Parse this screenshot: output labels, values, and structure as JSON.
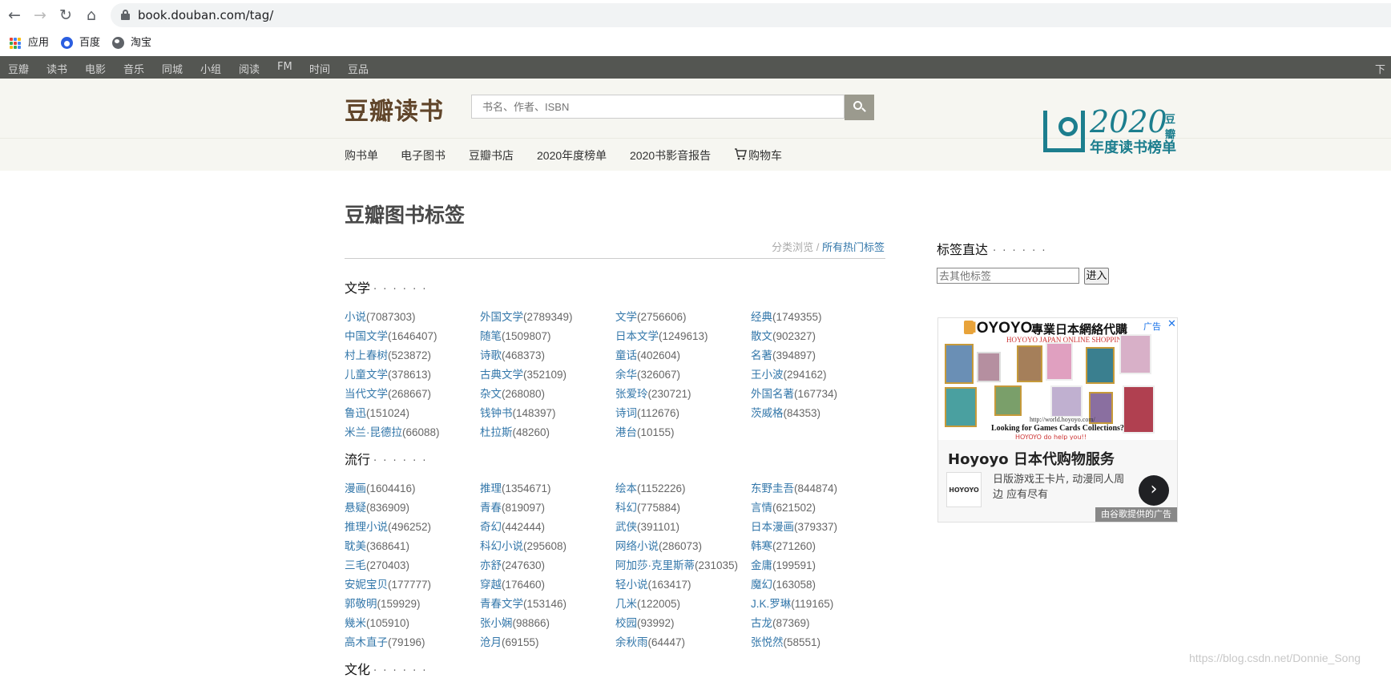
{
  "browser": {
    "url": "book.douban.com/tag/",
    "bookmarks": [
      "应用",
      "百度",
      "淘宝"
    ]
  },
  "global_nav": [
    "豆瓣",
    "读书",
    "电影",
    "音乐",
    "同城",
    "小组",
    "阅读",
    "FM",
    "时间",
    "豆品"
  ],
  "global_nav_right": "下载",
  "header": {
    "logo": "豆瓣读书",
    "search_placeholder": "书名、作者、ISBN",
    "subnav": [
      "购书单",
      "电子图书",
      "豆瓣书店",
      "2020年度榜单",
      "2020书影音报告",
      "购物车"
    ],
    "promo": {
      "year": "2020",
      "brand": "豆瓣",
      "subtitle": "年度读书榜单"
    }
  },
  "main": {
    "title": "豆瓣图书标签",
    "toplinks": {
      "inactive": "分类浏览",
      "separator": " / ",
      "active": "所有热门标签"
    },
    "sections": [
      {
        "name": "文学",
        "dots": "· · · · · ·",
        "tags": [
          {
            "name": "小说",
            "count": "(7087303)"
          },
          {
            "name": "外国文学",
            "count": "(2789349)"
          },
          {
            "name": "文学",
            "count": "(2756606)"
          },
          {
            "name": "经典",
            "count": "(1749355)"
          },
          {
            "name": "中国文学",
            "count": "(1646407)"
          },
          {
            "name": "随笔",
            "count": "(1509807)"
          },
          {
            "name": "日本文学",
            "count": "(1249613)"
          },
          {
            "name": "散文",
            "count": "(902327)"
          },
          {
            "name": "村上春树",
            "count": "(523872)"
          },
          {
            "name": "诗歌",
            "count": "(468373)"
          },
          {
            "name": "童话",
            "count": "(402604)"
          },
          {
            "name": "名著",
            "count": "(394897)"
          },
          {
            "name": "儿童文学",
            "count": "(378613)"
          },
          {
            "name": "古典文学",
            "count": "(352109)"
          },
          {
            "name": "余华",
            "count": "(326067)"
          },
          {
            "name": "王小波",
            "count": "(294162)"
          },
          {
            "name": "当代文学",
            "count": "(268667)"
          },
          {
            "name": "杂文",
            "count": "(268080)"
          },
          {
            "name": "张爱玲",
            "count": "(230721)"
          },
          {
            "name": "外国名著",
            "count": "(167734)"
          },
          {
            "name": "鲁迅",
            "count": "(151024)"
          },
          {
            "name": "钱钟书",
            "count": "(148397)"
          },
          {
            "name": "诗词",
            "count": "(112676)"
          },
          {
            "name": "茨威格",
            "count": "(84353)"
          },
          {
            "name": "米兰·昆德拉",
            "count": "(66088)"
          },
          {
            "name": "杜拉斯",
            "count": "(48260)"
          },
          {
            "name": "港台",
            "count": "(10155)"
          }
        ]
      },
      {
        "name": "流行",
        "dots": "· · · · · ·",
        "tags": [
          {
            "name": "漫画",
            "count": "(1604416)"
          },
          {
            "name": "推理",
            "count": "(1354671)"
          },
          {
            "name": "绘本",
            "count": "(1152226)"
          },
          {
            "name": "东野圭吾",
            "count": "(844874)"
          },
          {
            "name": "悬疑",
            "count": "(836909)"
          },
          {
            "name": "青春",
            "count": "(819097)"
          },
          {
            "name": "科幻",
            "count": "(775884)"
          },
          {
            "name": "言情",
            "count": "(621502)"
          },
          {
            "name": "推理小说",
            "count": "(496252)"
          },
          {
            "name": "奇幻",
            "count": "(442444)"
          },
          {
            "name": "武侠",
            "count": "(391101)"
          },
          {
            "name": "日本漫画",
            "count": "(379337)"
          },
          {
            "name": "耽美",
            "count": "(368641)"
          },
          {
            "name": "科幻小说",
            "count": "(295608)"
          },
          {
            "name": "网络小说",
            "count": "(286073)"
          },
          {
            "name": "韩寒",
            "count": "(271260)"
          },
          {
            "name": "三毛",
            "count": "(270403)"
          },
          {
            "name": "亦舒",
            "count": "(247630)"
          },
          {
            "name": "阿加莎·克里斯蒂",
            "count": "(231035)"
          },
          {
            "name": "金庸",
            "count": "(199591)"
          },
          {
            "name": "安妮宝贝",
            "count": "(177777)"
          },
          {
            "name": "穿越",
            "count": "(176460)"
          },
          {
            "name": "轻小说",
            "count": "(163417)"
          },
          {
            "name": "魔幻",
            "count": "(163058)"
          },
          {
            "name": "郭敬明",
            "count": "(159929)"
          },
          {
            "name": "青春文学",
            "count": "(153146)"
          },
          {
            "name": "几米",
            "count": "(122005)"
          },
          {
            "name": "J.K.罗琳",
            "count": "(119165)"
          },
          {
            "name": "幾米",
            "count": "(105910)"
          },
          {
            "name": "张小娴",
            "count": "(98866)"
          },
          {
            "name": "校园",
            "count": "(93992)"
          },
          {
            "name": "古龙",
            "count": "(87369)"
          },
          {
            "name": "高木直子",
            "count": "(79196)"
          },
          {
            "name": "沧月",
            "count": "(69155)"
          },
          {
            "name": "余秋雨",
            "count": "(64447)"
          },
          {
            "name": "张悦然",
            "count": "(58551)"
          }
        ]
      },
      {
        "name": "文化",
        "dots": "· · · · · ·",
        "tags": []
      }
    ]
  },
  "sidebar": {
    "heading": "标签直达",
    "dots": "· · · · · ·",
    "input_placeholder": "去其他标签",
    "button": "进入"
  },
  "ad": {
    "brand_prefix": "H",
    "brand": "OYOYO",
    "headline_jp": "專業日本網絡代購",
    "sub_jp": "HOYOYO JAPAN ONLINE SHOPPING",
    "badge": "广告",
    "url": "http://world.hoyoyo.com/",
    "caption": "Looking for Games Cards Collections?",
    "caption2": "HOYOYO do help you!!",
    "title": "Hoyoyo 日本代购物服务",
    "thumb_label": "HOYOYO",
    "text": "日版游戏王卡片, 动漫同人周边 应有尽有",
    "by": "由谷歌提供的广告"
  },
  "watermark": "https://blog.csdn.net/Donnie_Song"
}
